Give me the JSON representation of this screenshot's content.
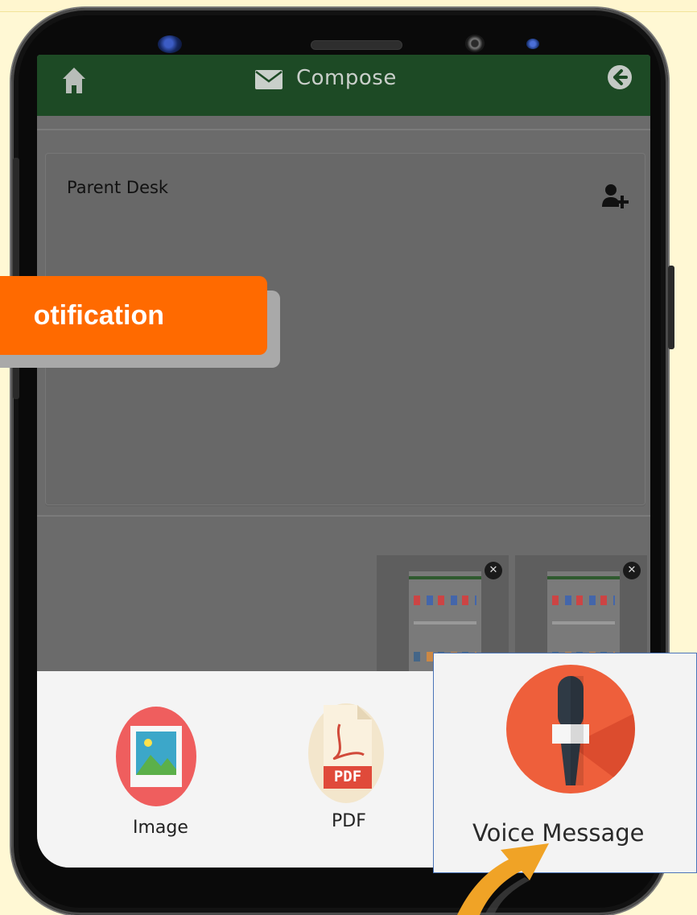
{
  "app": {
    "title": "Compose",
    "recipient": "Parent Desk"
  },
  "attachments": [
    {
      "label": "Image"
    },
    {
      "label": "PDF"
    },
    {
      "label": "Voice Message"
    }
  ],
  "pdf_badge": "PDF",
  "overlay": {
    "banner_text": "otification"
  },
  "colors": {
    "appbar": "#1d4a25",
    "banner": "#ff6a00",
    "voice_circle": "#ee5f3b",
    "arrow": "#f0a326"
  }
}
